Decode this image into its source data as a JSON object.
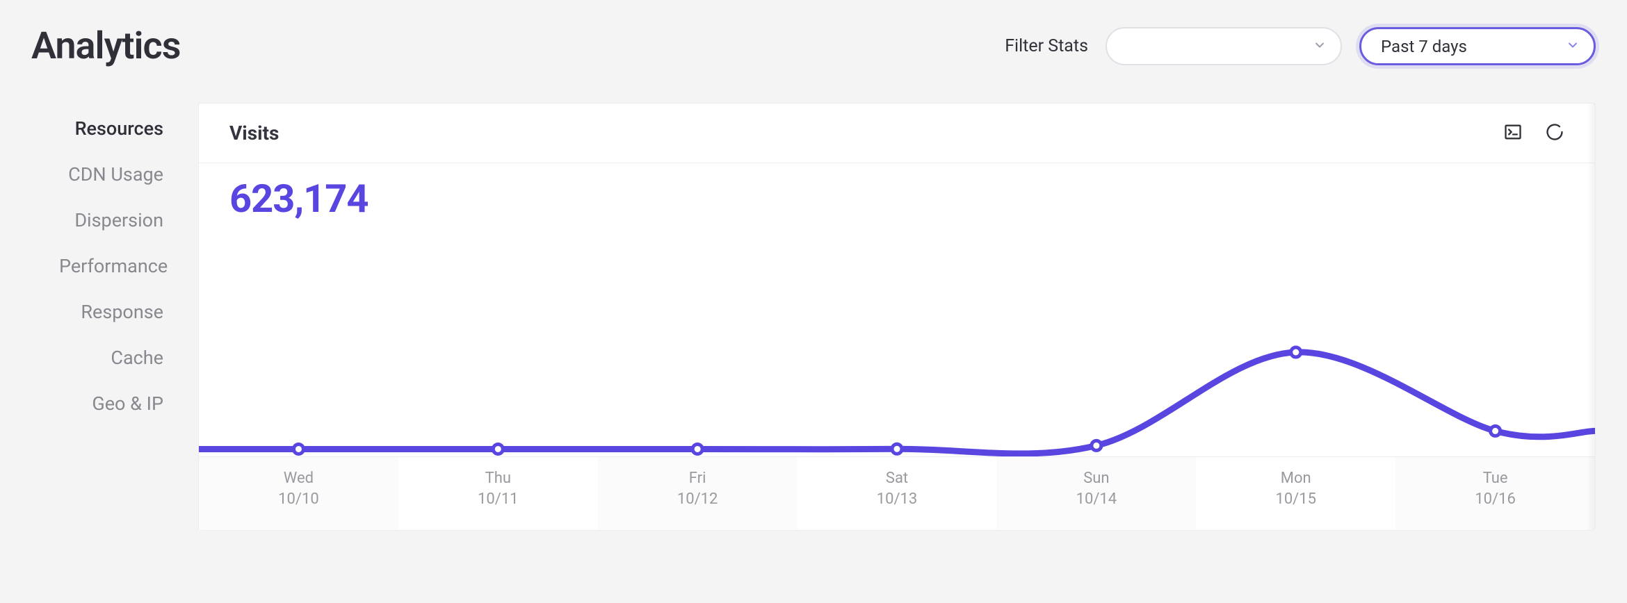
{
  "header": {
    "title": "Analytics",
    "filter_label": "Filter Stats",
    "filter_value": "",
    "range_value": "Past 7 days"
  },
  "sidebar": {
    "items": [
      {
        "label": "Resources",
        "active": true
      },
      {
        "label": "CDN Usage",
        "active": false
      },
      {
        "label": "Dispersion",
        "active": false
      },
      {
        "label": "Performance",
        "active": false
      },
      {
        "label": "Response",
        "active": false
      },
      {
        "label": "Cache",
        "active": false
      },
      {
        "label": "Geo & IP",
        "active": false
      }
    ]
  },
  "card": {
    "title": "Visits",
    "metric": "623,174"
  },
  "chart_data": {
    "type": "line",
    "title": "Visits",
    "xlabel": "",
    "ylabel": "",
    "x_ticks": [
      {
        "day": "Wed",
        "date": "10/10"
      },
      {
        "day": "Thu",
        "date": "10/11"
      },
      {
        "day": "Fri",
        "date": "10/12"
      },
      {
        "day": "Sat",
        "date": "10/13"
      },
      {
        "day": "Sun",
        "date": "10/14"
      },
      {
        "day": "Mon",
        "date": "10/15"
      },
      {
        "day": "Tue",
        "date": "10/16"
      }
    ],
    "series": [
      {
        "name": "Visits",
        "color": "#5946e1",
        "values": [
          2000,
          2000,
          2000,
          2500,
          20000,
          500000,
          95000
        ]
      }
    ],
    "ylim": [
      0,
      1000000
    ],
    "total": 623174
  }
}
